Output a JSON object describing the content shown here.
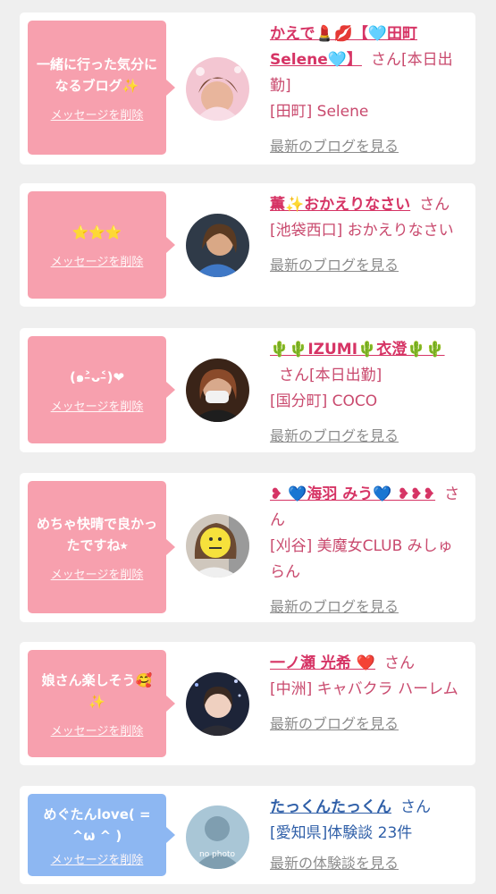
{
  "colors": {
    "pink_bubble": "#f7a0ae",
    "blue_bubble": "#8db7f2",
    "name_pink": "#d63465",
    "name_blue": "#2f5fa8",
    "link_gray": "#8c8c8c"
  },
  "items": [
    {
      "bubble_text": "一緒に行った気分になるブログ✨",
      "delete_label": "メッセージを削除",
      "name": "かえで💄💋【🩵田町Selene🩵】",
      "san": "さん",
      "status": "[本日出勤]",
      "shop": "[田町] Selene",
      "latest_link": "最新のブログを見る"
    },
    {
      "bubble_text": "⭐️⭐️⭐️",
      "delete_label": "メッセージを削除",
      "name": "薫✨おかえりなさい",
      "san": "さん",
      "status": "",
      "shop": "[池袋西口] おかえりなさい",
      "latest_link": "最新のブログを見る"
    },
    {
      "bubble_text": "(๑˃̵ᴗ˂̵)❤",
      "delete_label": "メッセージを削除",
      "name": "🌵🌵IZUMI🌵衣澄🌵🌵",
      "san": "さん",
      "status": "[本日出勤]",
      "shop": "[国分町] COCO",
      "latest_link": "最新のブログを見る"
    },
    {
      "bubble_text": "めちゃ快晴で良かったですね⭑",
      "delete_label": "メッセージを削除",
      "name": "❥ 💙海羽 みう💙 ❥❥❥",
      "san": "さん",
      "status": "",
      "shop": "[刈谷] 美魔女CLUB みしゅらん",
      "latest_link": "最新のブログを見る"
    },
    {
      "bubble_text": "娘さん楽しそう🥰✨",
      "delete_label": "メッセージを削除",
      "name": "一ノ瀬 光希 ❤️",
      "san": "さん",
      "status": "",
      "shop": "[中洲] キャバクラ ハーレム",
      "latest_link": "最新のブログを見る"
    },
    {
      "bubble_text": "めぐたんlove( = ^ω ^ )",
      "delete_label": "メッセージを削除",
      "name": "たっくんたっくん",
      "san": "さん",
      "status": "",
      "shop": "[愛知県]体験談 23件",
      "latest_link": "最新の体験談を見る",
      "avatar_text": "no photo"
    }
  ]
}
